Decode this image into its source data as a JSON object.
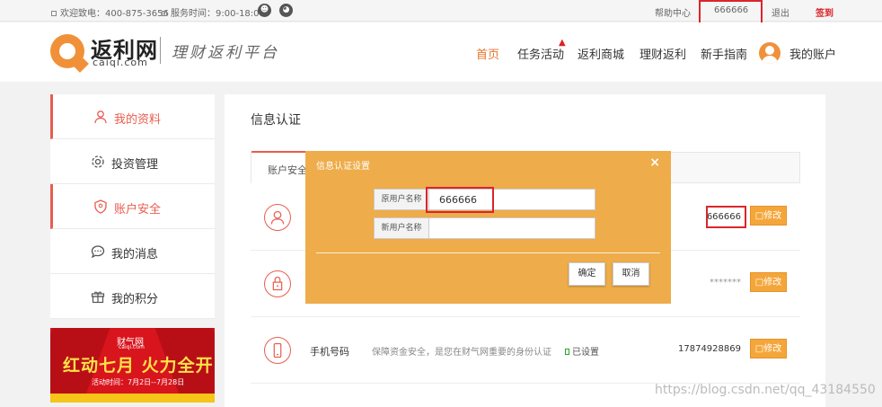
{
  "topbar": {
    "welcome": "欢迎致电：400-875-3656",
    "service_hours": "服务时间：9:00-18:00",
    "help_center": "帮助中心",
    "username": "666666",
    "logout": "退出",
    "checkin": "签到",
    "checkin_color": "#d9262c"
  },
  "logo": {
    "name": "返利网",
    "domain": "caiqi.com",
    "slogan": "理财返利平台",
    "brand_color": "#f0913a"
  },
  "nav": {
    "home": "首页",
    "tasks": "任务活动",
    "hot_badge": "HOT",
    "mall": "返利商城",
    "finance": "理财返利",
    "guide": "新手指南",
    "account": "我的账户",
    "active_color": "#e8732c"
  },
  "sidebar": {
    "items": [
      {
        "label": "我的资料",
        "icon": "user-icon",
        "selected": true
      },
      {
        "label": "投资管理",
        "icon": "gear-icon",
        "selected": false
      },
      {
        "label": "账户安全",
        "icon": "shield-icon",
        "selected": true
      },
      {
        "label": "我的消息",
        "icon": "chat-icon",
        "selected": false
      },
      {
        "label": "我的积分",
        "icon": "gift-icon",
        "selected": false
      }
    ]
  },
  "banner": {
    "logo_text": "财气网",
    "logo_sub": "caiqi.com",
    "title": "红动七月 火力全开",
    "subtitle": "活动时间：7月2日--7月28日"
  },
  "main": {
    "title": "信息认证",
    "tab": "账户安全",
    "rows": [
      {
        "icon": "user-icon",
        "value": "666666",
        "button": "修改"
      },
      {
        "icon": "lock-icon",
        "value": "*******",
        "button": "修改"
      },
      {
        "icon": "phone-icon",
        "label": "手机号码",
        "desc": "保障资金安全，是您在财气网重要的身份认证",
        "status": "已设置",
        "value": "17874928869",
        "button": "修改"
      }
    ]
  },
  "modal": {
    "title": "信息认证设置",
    "close": "×",
    "old_label": "原用户名称",
    "old_value": "666666",
    "new_label": "新用户名称",
    "new_value": "",
    "confirm": "确定",
    "cancel": "取消",
    "color": "#eeac4a"
  },
  "watermark": "https://blog.csdn.net/qq_43184550"
}
